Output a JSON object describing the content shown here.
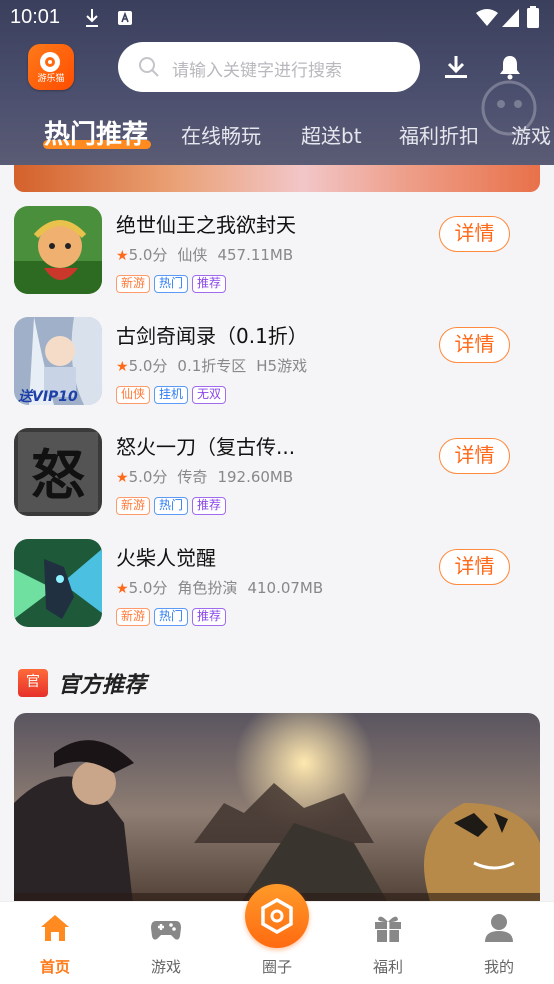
{
  "status_bar": {
    "time": "10:01"
  },
  "app": {
    "logo_text": "游乐猫"
  },
  "search": {
    "placeholder": "请输入关键字进行搜索"
  },
  "tabs": [
    {
      "label": "热门推荐"
    },
    {
      "label": "在线畅玩"
    },
    {
      "label": "超送bt"
    },
    {
      "label": "福利折扣"
    },
    {
      "label": "游戏"
    }
  ],
  "games": [
    {
      "name": "绝世仙王之我欲封天",
      "rating": "5.0分",
      "category": "仙侠",
      "size": "457.11MB",
      "tags": [
        "新游",
        "热门",
        "推荐"
      ],
      "button": "详情"
    },
    {
      "name": "古剑奇闻录（0.1折）",
      "rating": "5.0分",
      "category": "0.1折专区",
      "size": "H5游戏",
      "tags": [
        "仙侠",
        "挂机",
        "无双"
      ],
      "button": "详情",
      "icon_text": "送VIP10"
    },
    {
      "name": "怒火一刀（复古传...",
      "rating": "5.0分",
      "category": "传奇",
      "size": "192.60MB",
      "tags": [
        "新游",
        "热门",
        "推荐"
      ],
      "button": "详情",
      "icon_text": "怒"
    },
    {
      "name": "火柴人觉醒",
      "rating": "5.0分",
      "category": "角色扮演",
      "size": "410.07MB",
      "tags": [
        "新游",
        "热门",
        "推荐"
      ],
      "button": "详情"
    }
  ],
  "section": {
    "badge": "官",
    "title": "官方推荐"
  },
  "bottom_nav": [
    {
      "label": "首页",
      "icon": "home-icon"
    },
    {
      "label": "游戏",
      "icon": "gamepad-icon"
    },
    {
      "label": "圈子",
      "icon": "hexagon-icon"
    },
    {
      "label": "福利",
      "icon": "gift-icon"
    },
    {
      "label": "我的",
      "icon": "user-icon"
    }
  ],
  "colors": {
    "accent": "#ff7a1a",
    "header": "#3a3f5c"
  }
}
